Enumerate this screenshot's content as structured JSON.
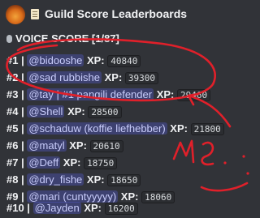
{
  "header": {
    "title": "Guild Score Leaderboards",
    "avatar_icon": "server-avatar-icon",
    "title_icon": "scroll-icon"
  },
  "section": {
    "title": "VOICE SCORE [1/87]",
    "icon": "microphone-icon"
  },
  "rows": [
    {
      "rank": "#1 |",
      "user": "@bidooshe",
      "xp_label": "XP:",
      "xp": "40840"
    },
    {
      "rank": "#2 |",
      "user": "@sad rubbishe",
      "xp_label": "XP:",
      "xp": "39300"
    },
    {
      "rank": "#3 |",
      "user": "@tay | #1 pangili defender",
      "xp_label": "XP:",
      "xp": "29460"
    },
    {
      "rank": "#4 |",
      "user": "@Shell",
      "xp_label": "XP:",
      "xp": "28500"
    },
    {
      "rank": "#5 |",
      "user": "@schaduw (koffie liefhebber)",
      "xp_label": "XP:",
      "xp": "21800"
    },
    {
      "rank": "#6 |",
      "user": "@matyl",
      "xp_label": "XP:",
      "xp": "20610"
    },
    {
      "rank": "#7 |",
      "user": "@Deff",
      "xp_label": "XP:",
      "xp": "18750"
    },
    {
      "rank": "#8 |",
      "user": "@dry_fishe",
      "xp_label": "XP:",
      "xp": "18650"
    },
    {
      "rank": "#9 |",
      "user": "@mari (cuntyyyyy)",
      "xp_label": "XP:",
      "xp": "18060"
    },
    {
      "rank": "#10 |",
      "user": "@Jayden",
      "xp_label": "XP:",
      "xp": "16200"
    }
  ],
  "annotation": {
    "handwritten_text": "me",
    "color": "#e0202a"
  }
}
